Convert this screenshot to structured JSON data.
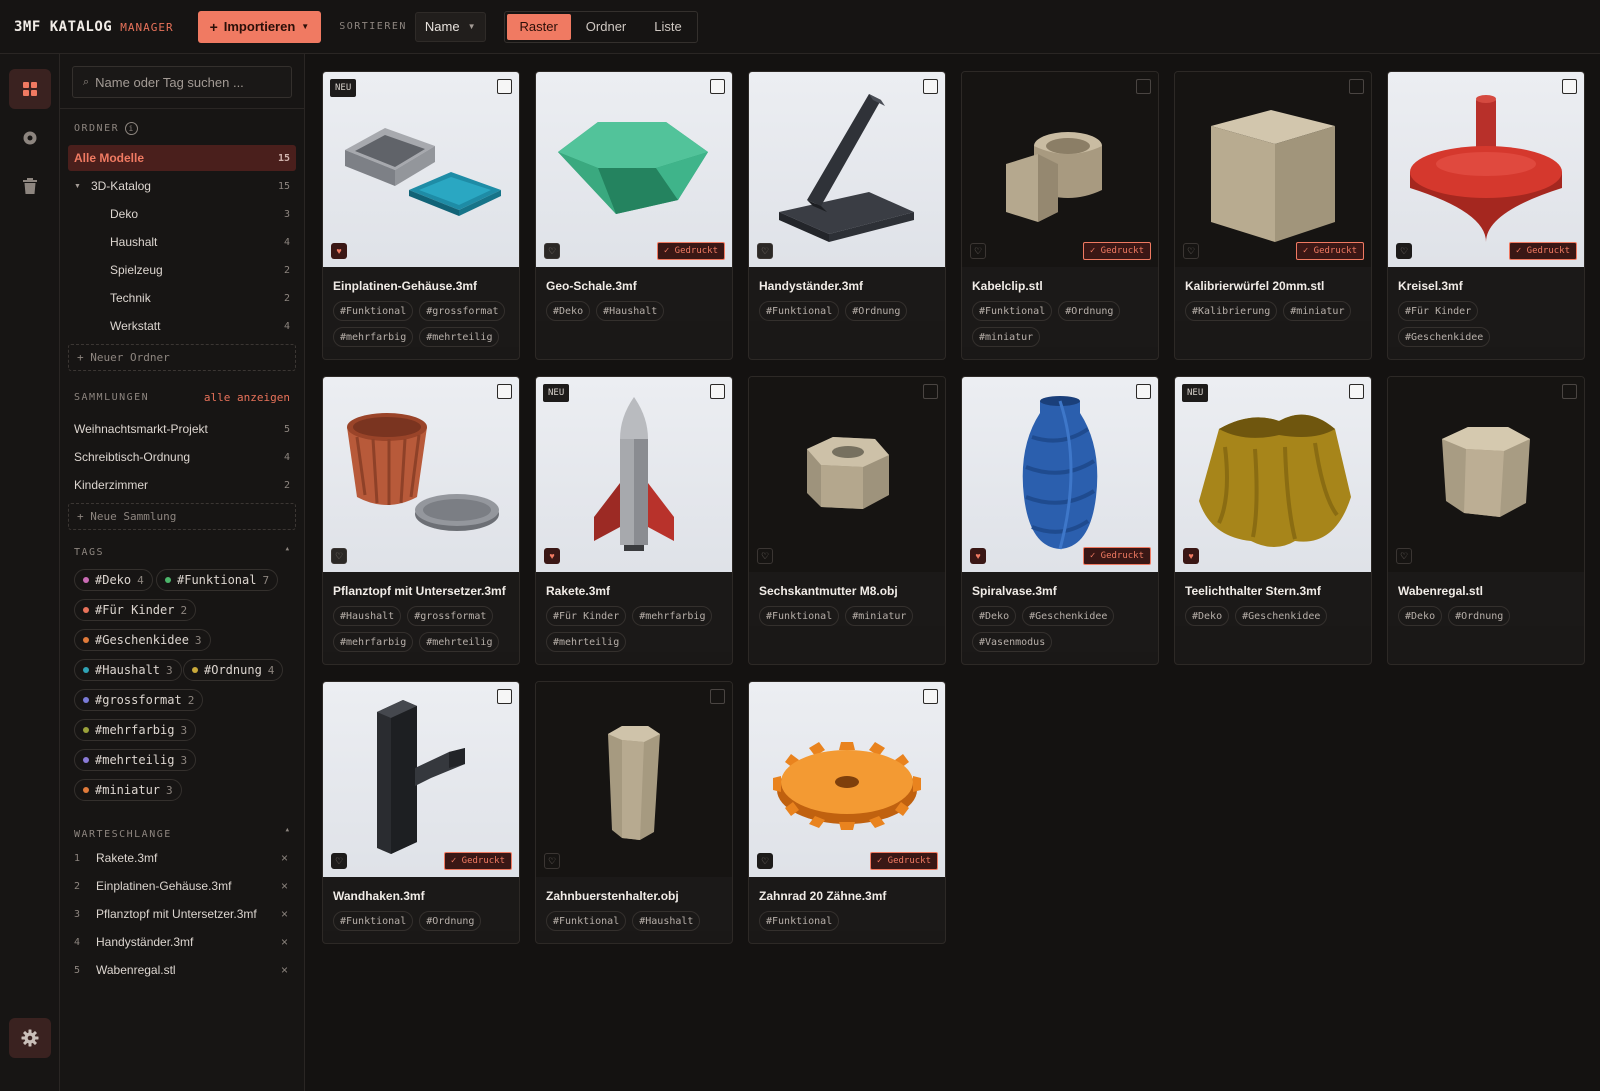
{
  "app": {
    "title": "3MF KATALOG",
    "subtitle": "MANAGER"
  },
  "toolbar": {
    "import_label": "Importieren",
    "sort_label": "SORTIEREN",
    "sort_value": "Name",
    "views": [
      "Raster",
      "Ordner",
      "Liste"
    ],
    "active_view": "Raster"
  },
  "search": {
    "placeholder": "Name oder Tag suchen ..."
  },
  "folders": {
    "heading": "ORDNER",
    "items": [
      {
        "label": "Alle Modelle",
        "count": "15"
      },
      {
        "label": "3D-Katalog",
        "count": "15"
      },
      {
        "label": "Deko",
        "count": "3"
      },
      {
        "label": "Haushalt",
        "count": "4"
      },
      {
        "label": "Spielzeug",
        "count": "2"
      },
      {
        "label": "Technik",
        "count": "2"
      },
      {
        "label": "Werkstatt",
        "count": "4"
      }
    ],
    "new_label": "+ Neuer Ordner"
  },
  "collections": {
    "heading": "SAMMLUNGEN",
    "show_all": "alle anzeigen",
    "items": [
      {
        "label": "Weihnachtsmarkt-Projekt",
        "count": "5"
      },
      {
        "label": "Schreibtisch-Ordnung",
        "count": "4"
      },
      {
        "label": "Kinderzimmer",
        "count": "2"
      }
    ],
    "new_label": "+ Neue Sammlung"
  },
  "tags": {
    "heading": "TAGS",
    "items": [
      {
        "label": "#Deko",
        "count": "4",
        "color": "#c96bb4"
      },
      {
        "label": "#Funktional",
        "count": "7",
        "color": "#4cb56a"
      },
      {
        "label": "#Für Kinder",
        "count": "2",
        "color": "#e8725a"
      },
      {
        "label": "#Geschenkidee",
        "count": "3",
        "color": "#e07a3a"
      },
      {
        "label": "#Haushalt",
        "count": "3",
        "color": "#2fa3b5"
      },
      {
        "label": "#Ordnung",
        "count": "4",
        "color": "#c9a93a"
      },
      {
        "label": "#grossformat",
        "count": "2",
        "color": "#7a7ad6"
      },
      {
        "label": "#mehrfarbig",
        "count": "3",
        "color": "#9aa13a"
      },
      {
        "label": "#mehrteilig",
        "count": "3",
        "color": "#8a7ad6"
      },
      {
        "label": "#miniatur",
        "count": "3",
        "color": "#e07a3a"
      }
    ]
  },
  "queue": {
    "heading": "WARTESCHLANGE",
    "items": [
      {
        "num": "1",
        "label": "Rakete.3mf"
      },
      {
        "num": "2",
        "label": "Einplatinen-Gehäuse.3mf"
      },
      {
        "num": "3",
        "label": "Pflanztopf mit Untersetzer.3mf"
      },
      {
        "num": "4",
        "label": "Handyständer.3mf"
      },
      {
        "num": "5",
        "label": "Wabenregal.stl"
      }
    ]
  },
  "badges": {
    "new": "NEU",
    "printed": "✓ Gedruckt"
  },
  "models": [
    {
      "title": "Einplatinen-Gehäuse.3mf",
      "tags": [
        "#Funktional",
        "#grossformat",
        "#mehrfarbig",
        "#mehrteilig"
      ],
      "new": true,
      "printed": false,
      "fav": true,
      "bg": "light"
    },
    {
      "title": "Geo-Schale.3mf",
      "tags": [
        "#Deko",
        "#Haushalt"
      ],
      "new": false,
      "printed": true,
      "fav": false,
      "bg": "light"
    },
    {
      "title": "Handyständer.3mf",
      "tags": [
        "#Funktional",
        "#Ordnung"
      ],
      "new": false,
      "printed": false,
      "fav": false,
      "bg": "light"
    },
    {
      "title": "Kabelclip.stl",
      "tags": [
        "#Funktional",
        "#Ordnung",
        "#miniatur"
      ],
      "new": false,
      "printed": true,
      "fav": false,
      "bg": "dark"
    },
    {
      "title": "Kalibrierwürfel 20mm.stl",
      "tags": [
        "#Kalibrierung",
        "#miniatur"
      ],
      "new": false,
      "printed": true,
      "fav": false,
      "bg": "dark"
    },
    {
      "title": "Kreisel.3mf",
      "tags": [
        "#Für Kinder",
        "#Geschenkidee"
      ],
      "new": false,
      "printed": true,
      "fav": false,
      "bg": "light"
    },
    {
      "title": "Pflanztopf mit Untersetzer.3mf",
      "tags": [
        "#Haushalt",
        "#grossformat",
        "#mehrfarbig",
        "#mehrteilig"
      ],
      "new": false,
      "printed": false,
      "fav": false,
      "bg": "light"
    },
    {
      "title": "Rakete.3mf",
      "tags": [
        "#Für Kinder",
        "#mehrfarbig",
        "#mehrteilig"
      ],
      "new": true,
      "printed": false,
      "fav": true,
      "bg": "light"
    },
    {
      "title": "Sechskantmutter M8.obj",
      "tags": [
        "#Funktional",
        "#miniatur"
      ],
      "new": false,
      "printed": false,
      "fav": false,
      "bg": "dark"
    },
    {
      "title": "Spiralvase.3mf",
      "tags": [
        "#Deko",
        "#Geschenkidee",
        "#Vasenmodus"
      ],
      "new": false,
      "printed": true,
      "fav": true,
      "bg": "light"
    },
    {
      "title": "Teelichthalter Stern.3mf",
      "tags": [
        "#Deko",
        "#Geschenkidee"
      ],
      "new": true,
      "printed": false,
      "fav": true,
      "bg": "light"
    },
    {
      "title": "Wabenregal.stl",
      "tags": [
        "#Deko",
        "#Ordnung"
      ],
      "new": false,
      "printed": false,
      "fav": false,
      "bg": "dark"
    },
    {
      "title": "Wandhaken.3mf",
      "tags": [
        "#Funktional",
        "#Ordnung"
      ],
      "new": false,
      "printed": true,
      "fav": false,
      "bg": "light"
    },
    {
      "title": "Zahnbuerstenhalter.obj",
      "tags": [
        "#Funktional",
        "#Haushalt"
      ],
      "new": false,
      "printed": false,
      "fav": false,
      "bg": "dark"
    },
    {
      "title": "Zahnrad 20 Zähne.3mf",
      "tags": [
        "#Funktional"
      ],
      "new": false,
      "printed": true,
      "fav": false,
      "bg": "light"
    }
  ],
  "icons": {
    "rail": [
      "grid-icon",
      "record-icon",
      "trash-icon",
      "settings-icon"
    ],
    "accent": "#f07a62"
  }
}
